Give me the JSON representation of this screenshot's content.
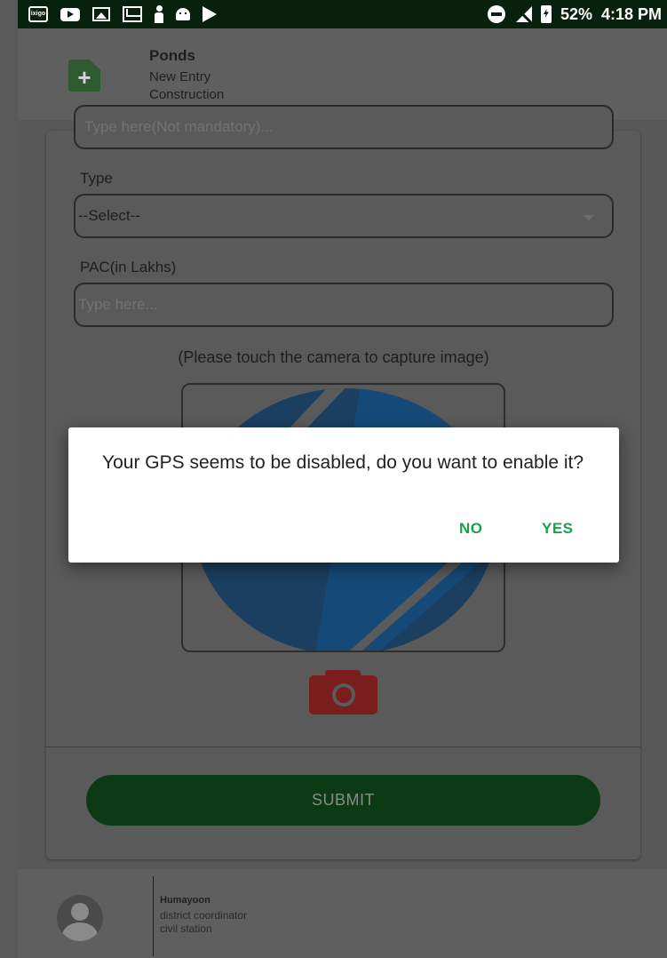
{
  "status_bar": {
    "battery": "52%",
    "time": "4:18 PM",
    "left_icons": [
      "ixigo-icon",
      "youtube-icon",
      "gallery-icon",
      "gmail-icon",
      "person-icon",
      "android-icon",
      "play-store-icon"
    ],
    "ixigo_text": "ixigo"
  },
  "header": {
    "title": "Ponds",
    "subtitle1": "New Entry",
    "subtitle2": "Construction"
  },
  "form": {
    "remarks_placeholder": "Type here(Not mandatory)...",
    "type_label": "Type",
    "type_value": "--Select--",
    "pac_label": "PAC(in Lakhs)",
    "pac_placeholder": "Type here...",
    "camera_hint": "(Please touch the camera to capture image)",
    "submit_label": "SUBMIT"
  },
  "footer": {
    "name": "Humayoon",
    "role": "district coordinator",
    "location": "civil station"
  },
  "dialog": {
    "message": "Your GPS seems to be disabled, do you want to enable it?",
    "no_label": "NO",
    "yes_label": "YES"
  },
  "colors": {
    "status_bar": "#08210c",
    "accent_green": "#17a34a",
    "submit_green": "#0c3a14",
    "camera_red": "#7a1d1d"
  }
}
